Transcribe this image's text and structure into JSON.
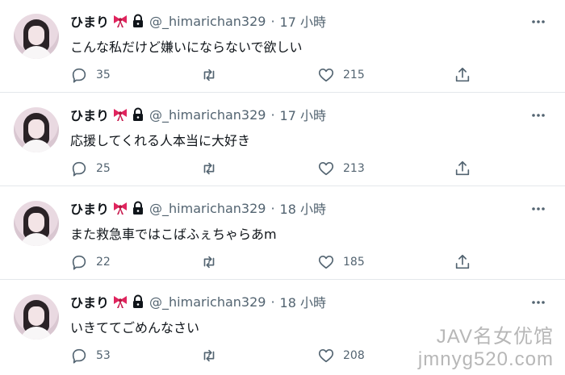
{
  "tweets": [
    {
      "name": "ひまり",
      "handle": "@_himarichan329",
      "dot": "·",
      "time": "17 小時",
      "text": "こんな私だけど嫌いにならないで欲しい",
      "replies": "35",
      "retweets": "",
      "likes": "215"
    },
    {
      "name": "ひまり",
      "handle": "@_himarichan329",
      "dot": "·",
      "time": "17 小時",
      "text": "応援してくれる人本当に大好き",
      "replies": "25",
      "retweets": "",
      "likes": "213"
    },
    {
      "name": "ひまり",
      "handle": "@_himarichan329",
      "dot": "·",
      "time": "18 小時",
      "text": "また救急車ではこばふぇちゃらあm",
      "replies": "22",
      "retweets": "",
      "likes": "185"
    },
    {
      "name": "ひまり",
      "handle": "@_himarichan329",
      "dot": "·",
      "time": "18 小時",
      "text": "いきててごめんなさい",
      "replies": "53",
      "retweets": "",
      "likes": "208"
    }
  ],
  "watermark": {
    "line1": "JAV名女优馆",
    "line2": "jmnyg520.com"
  },
  "colors": {
    "text": "#0f1419",
    "muted": "#536471",
    "bow": "#e0245e",
    "divider": "#e4e8eb"
  }
}
